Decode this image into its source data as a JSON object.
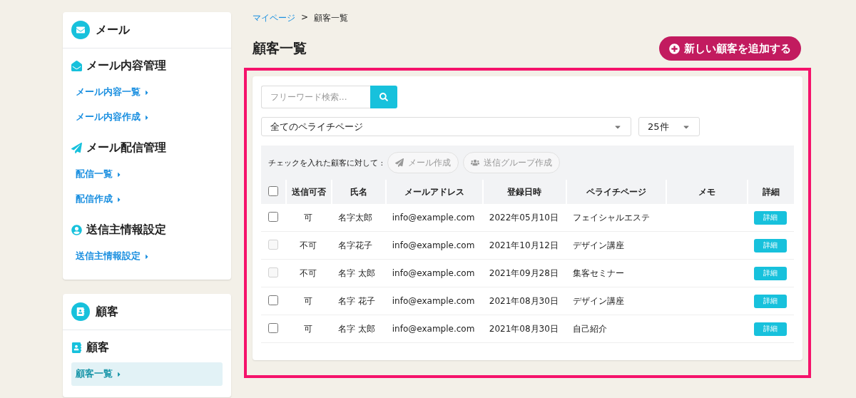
{
  "sidebar": {
    "groups": [
      {
        "title": "メール",
        "sections": [
          {
            "title": "メール内容管理",
            "links": [
              {
                "label": "メール内容一覧",
                "selected": false
              },
              {
                "label": "メール内容作成",
                "selected": false
              }
            ]
          },
          {
            "title": "メール配信管理",
            "links": [
              {
                "label": "配信一覧",
                "selected": false
              },
              {
                "label": "配信作成",
                "selected": false
              }
            ]
          },
          {
            "title": "送信主情報設定",
            "links": [
              {
                "label": "送信主情報設定",
                "selected": false
              }
            ]
          }
        ]
      },
      {
        "title": "顧客",
        "sections": [
          {
            "title": "顧客",
            "links": [
              {
                "label": "顧客一覧",
                "selected": true
              }
            ]
          }
        ]
      }
    ]
  },
  "breadcrumb": {
    "link": "マイページ",
    "separator": ">",
    "current": "顧客一覧"
  },
  "page_title": "顧客一覧",
  "add_button": "新しい顧客を追加する",
  "search": {
    "placeholder": "フリーワード検索..."
  },
  "page_select": "全てのペライチページ",
  "count_select": "25件",
  "bulk": {
    "label": "チェックを入れた顧客に対して :",
    "actions": [
      {
        "label": "メール作成",
        "disabled": true
      },
      {
        "label": "送信グループ作成",
        "disabled": true
      }
    ]
  },
  "table": {
    "select_all_checked": false,
    "columns": [
      "送信可否",
      "氏名",
      "メールアドレス",
      "登録日時",
      "ペライチページ",
      "メモ",
      "詳細"
    ],
    "rows": [
      {
        "checked": false,
        "disabled": false,
        "cells": [
          "可",
          "名字太郎",
          "info@example.com",
          "2022年05月10日",
          "フェイシャルエステ"
        ],
        "action": "詳細"
      },
      {
        "checked": false,
        "disabled": true,
        "cells": [
          "不可",
          "名字花子",
          "info@example.com",
          "2021年10月12日",
          "デザイン講座"
        ],
        "action": "詳細"
      },
      {
        "checked": false,
        "disabled": true,
        "cells": [
          "不可",
          "名字 太郎",
          "info@example.com",
          "2021年09月28日",
          "集客セミナー"
        ],
        "action": "詳細"
      },
      {
        "checked": false,
        "disabled": false,
        "cells": [
          "可",
          "名字 花子",
          "info@example.com",
          "2021年08月30日",
          "デザイン講座"
        ],
        "action": "詳細"
      },
      {
        "checked": false,
        "disabled": false,
        "cells": [
          "可",
          "名字 太郎",
          "info@example.com",
          "2021年08月30日",
          "自己紹介"
        ],
        "action": "詳細"
      }
    ]
  }
}
